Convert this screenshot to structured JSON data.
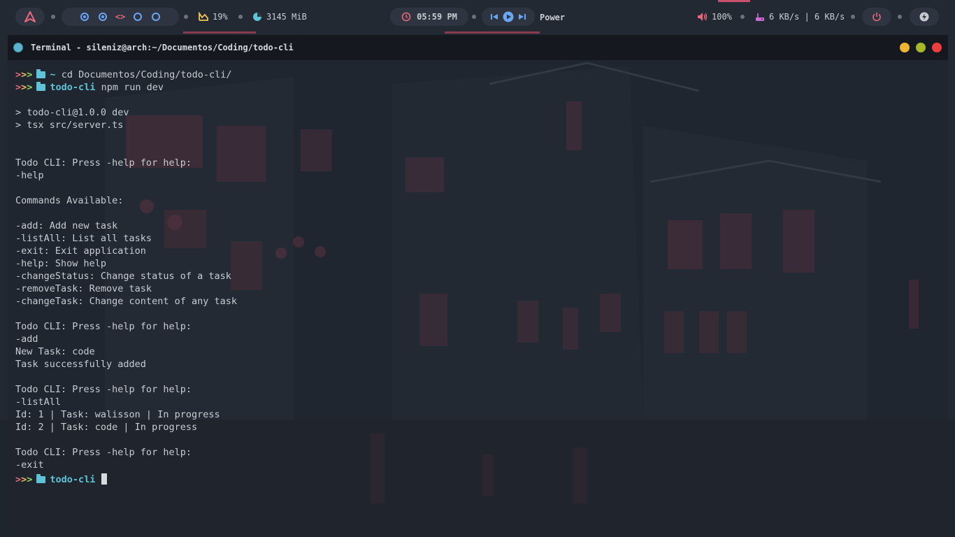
{
  "topbar": {
    "cpu_percent": "19%",
    "memory": "3145 MiB",
    "clock": "05:59 PM",
    "power_label": "Power",
    "volume": "100%",
    "network": "6 KB/s | 6 KB/s",
    "colors": {
      "accent": "#c9506a",
      "workspace": "#6aa6f5",
      "pill_bg": "#2e3540"
    }
  },
  "window": {
    "title": "Terminal - sileniz@arch:~/Documentos/Coding/todo-cli"
  },
  "terminal": {
    "prompt_symbol": ">>>",
    "home_dir": "~",
    "project_dir": "todo-cli",
    "cmd1": "cd Documentos/Coding/todo-cli/",
    "cmd2": "npm run dev",
    "npm1": "> todo-cli@1.0.0 dev",
    "npm2": "> tsx src/server.ts",
    "press_help": "Todo CLI: Press -help for help:",
    "help": "-help",
    "commands_title": "Commands Available:",
    "c_add": "-add: Add new task",
    "c_listall": "-listAll: List all tasks",
    "c_exit": "-exit: Exit application",
    "c_help": "-help: Show help",
    "c_changestatus": "-changeStatus: Change status of a task",
    "c_remove": "-removeTask: Remove task",
    "c_changetask": "-changeTask: Change content of any task",
    "add": "-add",
    "new_task": "New Task: code",
    "added": "Task successfully added",
    "listall": "-listAll",
    "task1": "Id: 1 | Task: walisson | In progress",
    "task2": "Id: 2 | Task: code | In progress",
    "exit": "-exit"
  }
}
